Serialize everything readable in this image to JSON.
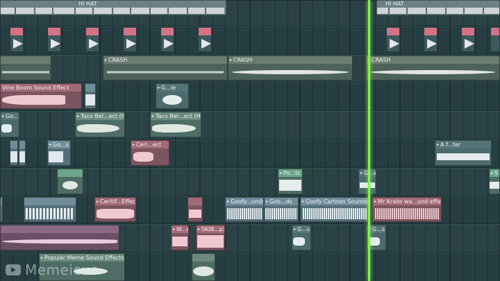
{
  "colors": {
    "playhead": "#7cfc3e",
    "grid_bg": "#263e42",
    "crash": "#6a7c72",
    "hat_clip": "#e07a8e",
    "vine": "#e29aa8",
    "green": "#6aa58a",
    "teal": "#6fa0aa",
    "pink": "#e8a0b0"
  },
  "tracks": [
    {
      "lane": "hihat",
      "clips": [
        {
          "label": "HI HAT",
          "color": "#9aa4a8",
          "kind": "bar"
        },
        {
          "label": "HI HAT",
          "color": "#9aa4a8",
          "kind": "bar"
        }
      ]
    },
    {
      "lane": "hat-hits",
      "clips": [
        {
          "label": "",
          "kind": "hit"
        },
        {
          "label": "",
          "kind": "hit"
        },
        {
          "label": "",
          "kind": "hit"
        },
        {
          "label": "",
          "kind": "hit"
        },
        {
          "label": "",
          "kind": "hit"
        },
        {
          "label": "",
          "kind": "hit"
        },
        {
          "label": "",
          "kind": "hit"
        },
        {
          "label": "",
          "kind": "hit"
        },
        {
          "label": "",
          "kind": "hit"
        },
        {
          "label": "",
          "kind": "hit"
        }
      ]
    },
    {
      "lane": "crash",
      "clips": [
        {
          "label": "",
          "kind": "wave"
        },
        {
          "label": "CRASH",
          "kind": "wave"
        },
        {
          "label": "CRASH",
          "kind": "wave"
        },
        {
          "label": "CRASH",
          "kind": "wave"
        }
      ]
    },
    {
      "lane": "vine",
      "clips": [
        {
          "label": "Vine Boom Sound Effect",
          "kind": "wave"
        },
        {
          "label": "",
          "kind": "wave"
        },
        {
          "label": "G...le",
          "kind": "wave"
        }
      ]
    },
    {
      "lane": "taco",
      "clips": [
        {
          "label": "Go...s",
          "kind": "wave"
        },
        {
          "label": "Taco Bel...ect (HD)",
          "kind": "wave"
        },
        {
          "label": "Taco Bel...ect (HD)",
          "kind": "wave"
        }
      ]
    },
    {
      "lane": "ceri",
      "clips": [
        {
          "label": "",
          "kind": "wave"
        },
        {
          "label": "",
          "kind": "wave"
        },
        {
          "label": "Go...s",
          "kind": "wave"
        },
        {
          "label": "Ceri...ect",
          "kind": "wave"
        },
        {
          "label": "A f...ter",
          "kind": "wave"
        }
      ]
    },
    {
      "lane": "pots",
      "clips": [
        {
          "label": "",
          "kind": "wave"
        },
        {
          "label": "",
          "kind": "wave"
        },
        {
          "label": "Po...ts",
          "kind": "wave"
        },
        {
          "label": "G...e",
          "kind": "wave"
        },
        {
          "label": "S",
          "kind": "wave"
        }
      ]
    },
    {
      "lane": "goofy",
      "clips": [
        {
          "label": "",
          "kind": "wave"
        },
        {
          "label": "",
          "kind": "wave"
        },
        {
          "label": "Ceritif...Effect",
          "kind": "wave"
        },
        {
          "label": "",
          "kind": "wave"
        },
        {
          "label": "Goofy...unds",
          "kind": "wave"
        },
        {
          "label": "Goo...ds",
          "kind": "wave"
        },
        {
          "label": "Goofy Cartoon Sounds",
          "kind": "wave"
        },
        {
          "label": "Mr Krabs wa...und effect",
          "kind": "wave"
        }
      ]
    },
    {
      "lane": "skib",
      "clips": [
        {
          "label": "",
          "kind": "wave"
        },
        {
          "label": "W...e",
          "kind": "wave"
        },
        {
          "label": "SKIB...p3",
          "kind": "wave"
        },
        {
          "label": "G...s",
          "kind": "wave"
        },
        {
          "label": "G...s",
          "kind": "wave"
        }
      ]
    },
    {
      "lane": "meme",
      "clips": [
        {
          "label": "Popular Meme Sound Effects",
          "kind": "wave"
        },
        {
          "label": "",
          "kind": "wave"
        }
      ]
    }
  ],
  "watermark": {
    "icon": "play-icon",
    "text": "Memeicus"
  }
}
